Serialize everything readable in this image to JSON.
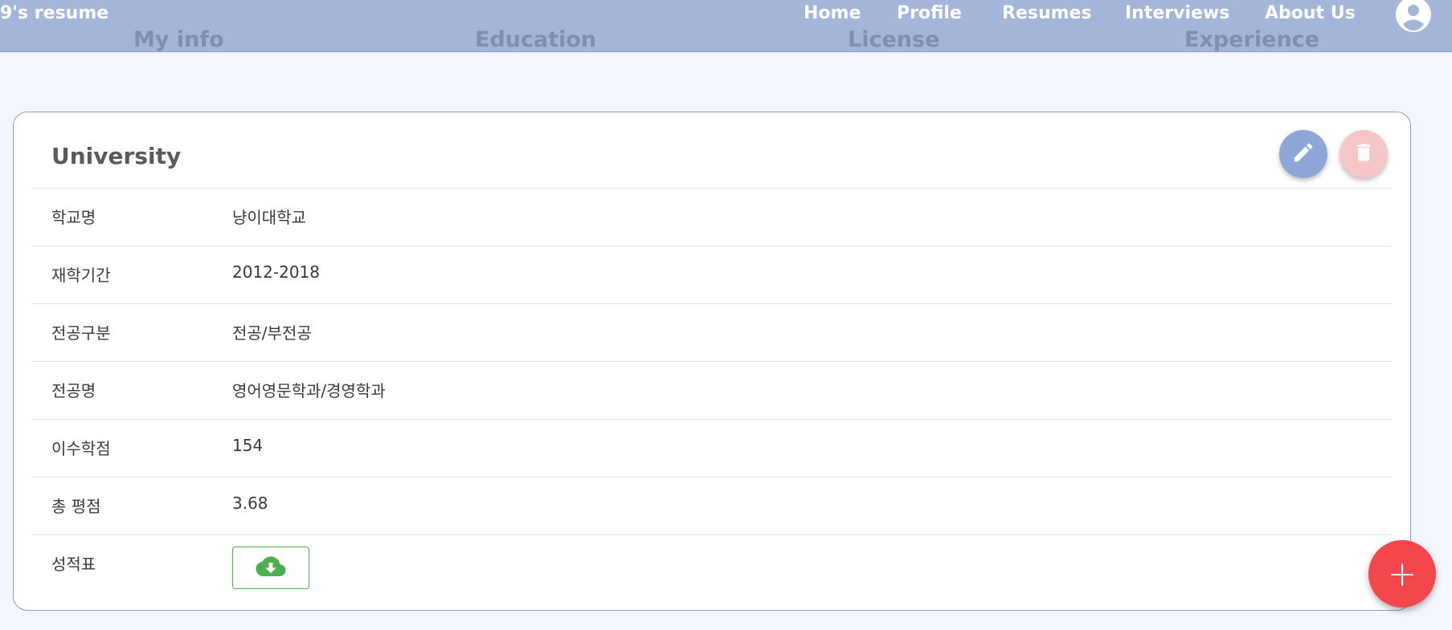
{
  "header": {
    "brand": "9's resume",
    "nav": [
      "Home",
      "Profile",
      "Resumes",
      "Interviews",
      "About Us"
    ],
    "account_icon": "account-circle-icon"
  },
  "section_tabs": [
    "My info",
    "Education",
    "License",
    "Experience"
  ],
  "card": {
    "title": "University",
    "edit_icon": "pencil-icon",
    "delete_icon": "trash-icon",
    "rows": [
      {
        "label": "학교명",
        "value": "냥이대학교"
      },
      {
        "label": "재학기간",
        "value": "2012-2018"
      },
      {
        "label": "전공구분",
        "value": "전공/부전공"
      },
      {
        "label": "전공명",
        "value": "영어영문학과/경영학과"
      },
      {
        "label": "이수학점",
        "value": "154"
      },
      {
        "label": "총 평점",
        "value": "3.68"
      },
      {
        "label": "성적표",
        "value": ""
      }
    ],
    "download_icon": "cloud-download-icon"
  },
  "fab": {
    "label": "+",
    "icon": "plus-icon"
  },
  "colors": {
    "header_bg": "#a3b5d8",
    "page_bg": "#f3f7fd",
    "edit_button": "#8fa6d9",
    "delete_button": "#f5c6c8",
    "add_button": "#f4474d",
    "download_green": "#4caf50"
  }
}
